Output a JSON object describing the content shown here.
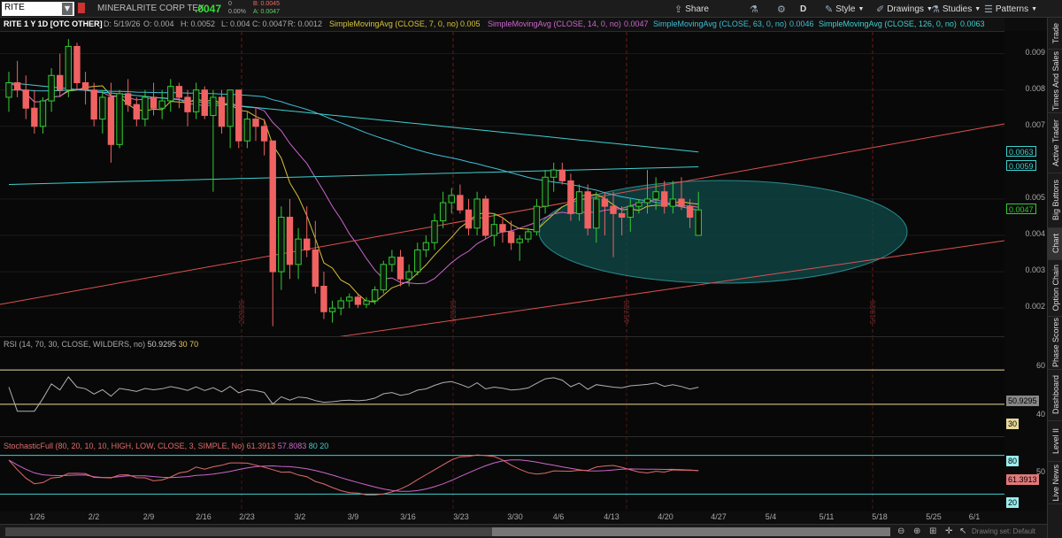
{
  "toolbar": {
    "symbol": "RITE",
    "company": "MINERALRITE CORP TEX",
    "last": ".0047",
    "change": "0",
    "change_pct": "0.00%",
    "bid": "B: 0.0045",
    "ask": "A: 0.0047",
    "share": "Share",
    "flask": "⚗",
    "period_btn": "D",
    "style": "Style",
    "drawings": "Drawings",
    "studies": "Studies",
    "patterns": "Patterns"
  },
  "study_header": {
    "title": "RITE 1 Y 1D [OTC OTHER]",
    "date": "D: 5/19/26",
    "open": "O: 0.004",
    "high": "H: 0.0052",
    "low": "L: 0.004",
    "close": "C: 0.0047",
    "range": "R: 0.0012",
    "sma7": "SimpleMovingAvg (CLOSE, 7, 0, no)",
    "sma7_val": "0.005",
    "sma14": "SimpleMovingAvg (CLOSE, 14, 0, no)",
    "sma14_val": "0.0047",
    "sma63": "SimpleMovingAvg (CLOSE, 63, 0, no)",
    "sma63_val": "0.0046",
    "sma126": "SimpleMovingAvg (CLOSE, 126, 0, no)",
    "sma126_val": "0.0063"
  },
  "price_axis": [
    "0.009",
    "0.008",
    "0.007",
    "0.005",
    "0.004",
    "0.003",
    "0.002"
  ],
  "price_badges": [
    {
      "text": "0.0063",
      "color": "#3fd0d0"
    },
    {
      "text": "0.0059",
      "color": "#3fd0d0"
    },
    {
      "text": "0.0047",
      "color": "#33cc33"
    }
  ],
  "event_labels": [
    "2/20/26",
    "3/20/26",
    "4/17/26",
    "5/19/26"
  ],
  "rsi": {
    "label": "RSI (14, 70, 30, CLOSE, WILDERS, no)",
    "value": "50.9295",
    "lower": "30",
    "upper": "70",
    "axis": [
      "60",
      "40"
    ]
  },
  "stoch": {
    "label": "StochasticFull (80, 20, 10, 10, HIGH, LOW, CLOSE, 3, SIMPLE, No)",
    "k": "61.3913",
    "d": "57.8083",
    "upper": "80",
    "lower": "20",
    "axis": [
      "50"
    ]
  },
  "dates": [
    "1/26",
    "2/2",
    "2/9",
    "2/16",
    "2/23",
    "3/2",
    "3/9",
    "3/16",
    "3/23",
    "3/30",
    "4/6",
    "4/13",
    "4/20",
    "4/27",
    "5/4",
    "5/11",
    "5/18",
    "5/25",
    "6/1"
  ],
  "sidebar": [
    "Trade",
    "Times And Sales",
    "Active Trader",
    "Big Buttons",
    "Chart",
    "Option Chain",
    "Phase Scores",
    "Dashboard",
    "Level II",
    "Live News"
  ],
  "sidebar_active": "Chart",
  "footer": {
    "drawing_set": "Drawing set: Default"
  },
  "colors": {
    "up": "#33cc33",
    "down": "#f06262",
    "sma7": "#d8c23a",
    "sma14": "#cc66cc",
    "sma63": "#3fbfd6",
    "sma126": "#3fd0d0",
    "trend": "#e05050",
    "bg": "#080808"
  },
  "chart_data": {
    "type": "candlestick",
    "ohlc": [
      [
        "1/22",
        0.0078,
        0.0085,
        0.0074,
        0.0082
      ],
      [
        "1/23",
        0.0082,
        0.0088,
        0.0078,
        0.008
      ],
      [
        "1/26",
        0.008,
        0.0084,
        0.0072,
        0.0075
      ],
      [
        "1/27",
        0.0075,
        0.008,
        0.0068,
        0.007
      ],
      [
        "1/28",
        0.007,
        0.0078,
        0.0068,
        0.0077
      ],
      [
        "1/29",
        0.0077,
        0.0086,
        0.0074,
        0.0084
      ],
      [
        "1/30",
        0.0084,
        0.009,
        0.0078,
        0.008
      ],
      [
        "2/2",
        0.008,
        0.0094,
        0.0078,
        0.0092
      ],
      [
        "2/3",
        0.0092,
        0.0093,
        0.008,
        0.0082
      ],
      [
        "2/4",
        0.0082,
        0.0085,
        0.0076,
        0.008
      ],
      [
        "2/5",
        0.008,
        0.0082,
        0.007,
        0.0072
      ],
      [
        "2/6",
        0.0072,
        0.008,
        0.0068,
        0.0078
      ],
      [
        "2/9",
        0.0078,
        0.0082,
        0.006,
        0.0065
      ],
      [
        "2/10",
        0.0065,
        0.008,
        0.0064,
        0.0079
      ],
      [
        "2/11",
        0.0079,
        0.0083,
        0.0074,
        0.0076
      ],
      [
        "2/12",
        0.0076,
        0.0078,
        0.007,
        0.0072
      ],
      [
        "2/13",
        0.0072,
        0.008,
        0.007,
        0.0078
      ],
      [
        "2/17",
        0.0078,
        0.0082,
        0.0073,
        0.0075
      ],
      [
        "2/18",
        0.0075,
        0.008,
        0.0072,
        0.0077
      ],
      [
        "2/19",
        0.0077,
        0.0083,
        0.0074,
        0.0081
      ],
      [
        "2/20",
        0.0081,
        0.0082,
        0.0075,
        0.0078
      ],
      [
        "2/23",
        0.0078,
        0.008,
        0.007,
        0.0074
      ],
      [
        "2/24",
        0.0074,
        0.0082,
        0.0072,
        0.008
      ],
      [
        "2/25",
        0.008,
        0.0081,
        0.0072,
        0.0073
      ],
      [
        "2/26",
        0.0073,
        0.008,
        0.0052,
        0.0078
      ],
      [
        "2/27",
        0.0078,
        0.008,
        0.0068,
        0.007
      ],
      [
        "3/2",
        0.007,
        0.008,
        0.0064,
        0.008
      ],
      [
        "3/3",
        0.008,
        0.008,
        0.0064,
        0.0066
      ],
      [
        "3/4",
        0.0066,
        0.0074,
        0.0064,
        0.0072
      ],
      [
        "3/5",
        0.0072,
        0.0075,
        0.0066,
        0.007
      ],
      [
        "3/6",
        0.007,
        0.0072,
        0.0062,
        0.0066
      ],
      [
        "3/9",
        0.0066,
        0.0066,
        0.0015,
        0.003
      ],
      [
        "3/10",
        0.003,
        0.0048,
        0.0025,
        0.0045
      ],
      [
        "3/11",
        0.0045,
        0.005,
        0.0028,
        0.0032
      ],
      [
        "3/12",
        0.0032,
        0.0042,
        0.0028,
        0.0039
      ],
      [
        "3/13",
        0.0039,
        0.0048,
        0.0034,
        0.0036
      ],
      [
        "3/16",
        0.0036,
        0.0044,
        0.0024,
        0.0026
      ],
      [
        "3/17",
        0.0026,
        0.003,
        0.0017,
        0.0019
      ],
      [
        "3/18",
        0.0019,
        0.0022,
        0.0016,
        0.002
      ],
      [
        "3/19",
        0.002,
        0.0023,
        0.0018,
        0.0022
      ],
      [
        "3/20",
        0.0022,
        0.0024,
        0.002,
        0.0023
      ],
      [
        "3/23",
        0.0023,
        0.0024,
        0.002,
        0.0021
      ],
      [
        "3/24",
        0.0021,
        0.0023,
        0.002,
        0.0022
      ],
      [
        "3/25",
        0.0022,
        0.0026,
        0.0021,
        0.0025
      ],
      [
        "3/26",
        0.0025,
        0.0033,
        0.0024,
        0.0032
      ],
      [
        "3/27",
        0.0032,
        0.0036,
        0.003,
        0.0034
      ],
      [
        "3/30",
        0.0034,
        0.0036,
        0.0026,
        0.0028
      ],
      [
        "3/31",
        0.0028,
        0.0032,
        0.0026,
        0.003
      ],
      [
        "4/1",
        0.003,
        0.0038,
        0.0029,
        0.0036
      ],
      [
        "4/2",
        0.0036,
        0.004,
        0.0034,
        0.0038
      ],
      [
        "4/6",
        0.0038,
        0.0046,
        0.0036,
        0.0044
      ],
      [
        "4/7",
        0.0044,
        0.0052,
        0.0042,
        0.0049
      ],
      [
        "4/8",
        0.0049,
        0.0053,
        0.0046,
        0.0051
      ],
      [
        "4/9",
        0.0051,
        0.0054,
        0.0046,
        0.0047
      ],
      [
        "4/10",
        0.0047,
        0.005,
        0.004,
        0.0042
      ],
      [
        "4/13",
        0.0042,
        0.0052,
        0.004,
        0.005
      ],
      [
        "4/14",
        0.005,
        0.0051,
        0.0039,
        0.004
      ],
      [
        "4/15",
        0.004,
        0.0046,
        0.0037,
        0.0043
      ],
      [
        "4/16",
        0.0043,
        0.0045,
        0.0038,
        0.0041
      ],
      [
        "4/17",
        0.0041,
        0.0044,
        0.0036,
        0.0038
      ],
      [
        "4/20",
        0.0038,
        0.004,
        0.0033,
        0.0039
      ],
      [
        "4/21",
        0.0039,
        0.0042,
        0.0038,
        0.0041
      ],
      [
        "4/22",
        0.0041,
        0.005,
        0.004,
        0.0048
      ],
      [
        "4/23",
        0.0048,
        0.0058,
        0.0046,
        0.0056
      ],
      [
        "4/24",
        0.0056,
        0.006,
        0.0052,
        0.0058
      ],
      [
        "4/27",
        0.0058,
        0.006,
        0.0054,
        0.0055
      ],
      [
        "4/28",
        0.0055,
        0.0057,
        0.0044,
        0.0046
      ],
      [
        "4/29",
        0.0046,
        0.0054,
        0.0044,
        0.0052
      ],
      [
        "4/30",
        0.0052,
        0.0054,
        0.004,
        0.0042
      ],
      [
        "5/1",
        0.0042,
        0.0052,
        0.0038,
        0.005
      ],
      [
        "5/4",
        0.005,
        0.0052,
        0.004,
        0.0048
      ],
      [
        "5/5",
        0.0048,
        0.0052,
        0.0034,
        0.0046
      ],
      [
        "5/6",
        0.0046,
        0.0048,
        0.004,
        0.0045
      ],
      [
        "5/7",
        0.0045,
        0.005,
        0.0041,
        0.0048
      ],
      [
        "5/8",
        0.0048,
        0.005,
        0.0046,
        0.0049
      ],
      [
        "5/11",
        0.0049,
        0.0058,
        0.0046,
        0.005
      ],
      [
        "5/12",
        0.005,
        0.0056,
        0.0047,
        0.0052
      ],
      [
        "5/13",
        0.0052,
        0.0055,
        0.0046,
        0.0048
      ],
      [
        "5/14",
        0.0048,
        0.0055,
        0.0046,
        0.005
      ],
      [
        "5/15",
        0.005,
        0.0056,
        0.0047,
        0.0048
      ],
      [
        "5/18",
        0.0048,
        0.005,
        0.0042,
        0.0045
      ],
      [
        "5/19",
        0.004,
        0.0052,
        0.004,
        0.0047
      ]
    ],
    "ylim": [
      0.0012,
      0.0096
    ]
  }
}
